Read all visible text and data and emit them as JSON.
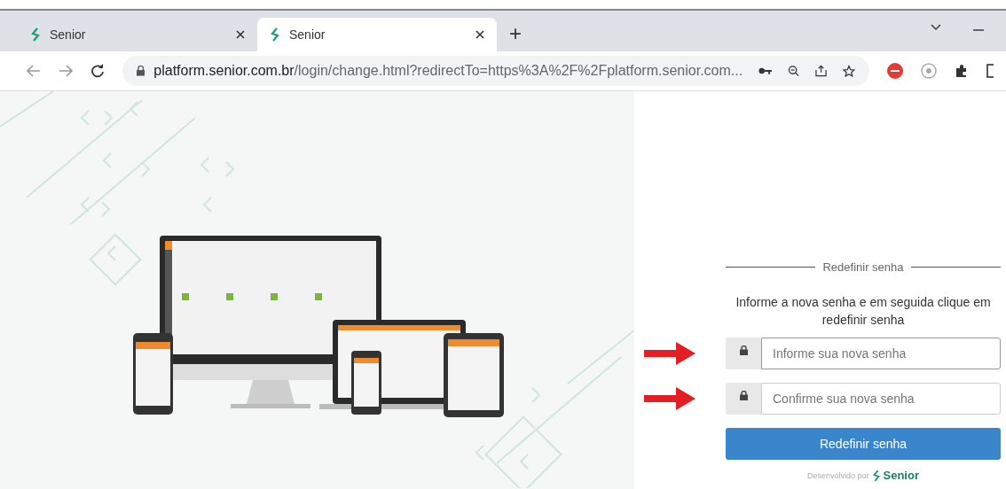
{
  "browser": {
    "tabs": [
      {
        "title": "Senior",
        "selected": false
      },
      {
        "title": "Senior",
        "selected": true
      }
    ],
    "new_tab": "+",
    "url_host": "platform.senior.com.br",
    "url_path": "/login/change.html?redirectTo=https%3A%2F%2Fplatform.senior.com..."
  },
  "form": {
    "heading": "Redefinir senha",
    "instructions": "Informe a nova senha e em seguida clique em redefinir senha",
    "fields": [
      {
        "placeholder": "Informe sua nova senha",
        "focused": true
      },
      {
        "placeholder": "Confirme sua nova senha",
        "focused": false
      }
    ],
    "submit": "Redefinir senha",
    "footer_prefix": "Desenvolvido por",
    "footer_brand": "Senior"
  }
}
